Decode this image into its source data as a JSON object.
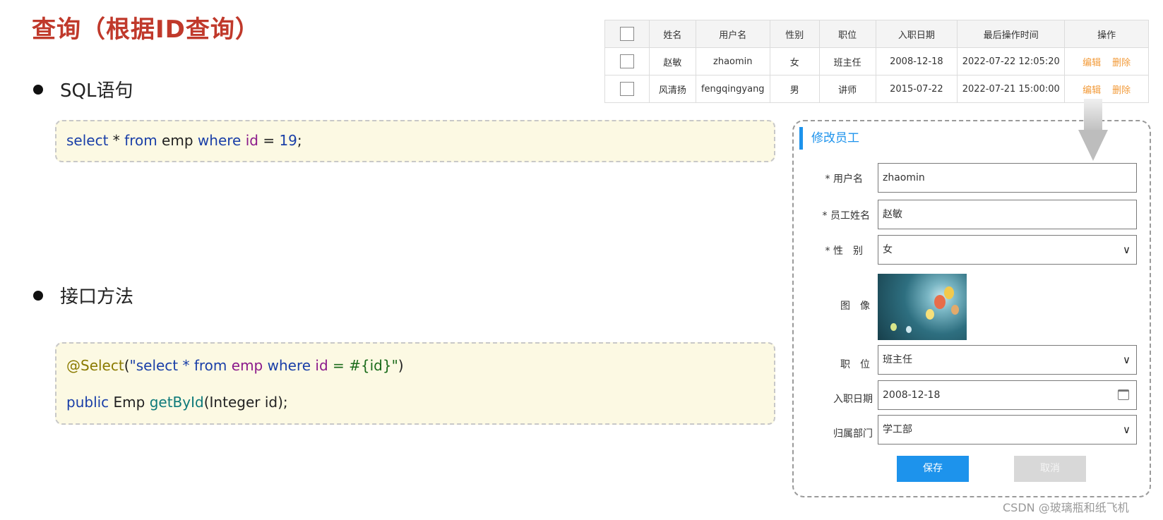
{
  "slide": {
    "title": "查询（根据ID查询）",
    "bullet1": "SQL语句",
    "bullet2": "接口方法"
  },
  "code1": {
    "t1": "select",
    "t2": " * ",
    "t3": "from",
    "t4": " emp ",
    "t5": "where",
    "t6": " ",
    "t7": "id",
    "t8": " = ",
    "t9": "19",
    "t10": ";"
  },
  "code2": {
    "l1a": "@Select",
    "l1b": "(",
    "l1c": "\"select * from ",
    "l1d": "emp",
    "l1e": " where ",
    "l1f": "id",
    "l1g": " = #{id}\"",
    "l1h": ")",
    "l2a": "public",
    "l2b": " Emp ",
    "l2c": "getById",
    "l2d": "(Integer id);"
  },
  "table": {
    "headers": [
      "姓名",
      "用户名",
      "性别",
      "职位",
      "入职日期",
      "最后操作时间",
      "操作"
    ],
    "rows": [
      [
        "赵敏",
        "zhaomin",
        "女",
        "班主任",
        "2008-12-18",
        "2022-07-22 12:05:20"
      ],
      [
        "风清扬",
        "fengqingyang",
        "男",
        "讲师",
        "2015-07-22",
        "2022-07-21 15:00:00"
      ]
    ],
    "edit_label": "编辑",
    "delete_label": "删除"
  },
  "form": {
    "title": "修改员工",
    "username_label": "* 用户名",
    "username_value": "zhaomin",
    "name_label": "* 员工姓名",
    "name_value": "赵敏",
    "gender_label": "* 性　别",
    "gender_value": "女",
    "image_label": "图　像",
    "job_label": "职　位",
    "job_value": "班主任",
    "entry_label": "入职日期",
    "entry_value": "2008-12-18",
    "dept_label": "归属部门",
    "dept_value": "学工部",
    "save_label": "保存",
    "cancel_label": "取消"
  },
  "icons": {
    "dropdown": "chevron-down-icon",
    "calendar": "calendar-icon",
    "arrow": "arrow-down-icon"
  },
  "colors": {
    "title_red": "#c0392b",
    "accent_blue": "#1d93ec",
    "action_orange": "#f29a38",
    "code_bg": "#fcf9e3"
  },
  "watermark": "CSDN @玻璃瓶和纸飞机"
}
